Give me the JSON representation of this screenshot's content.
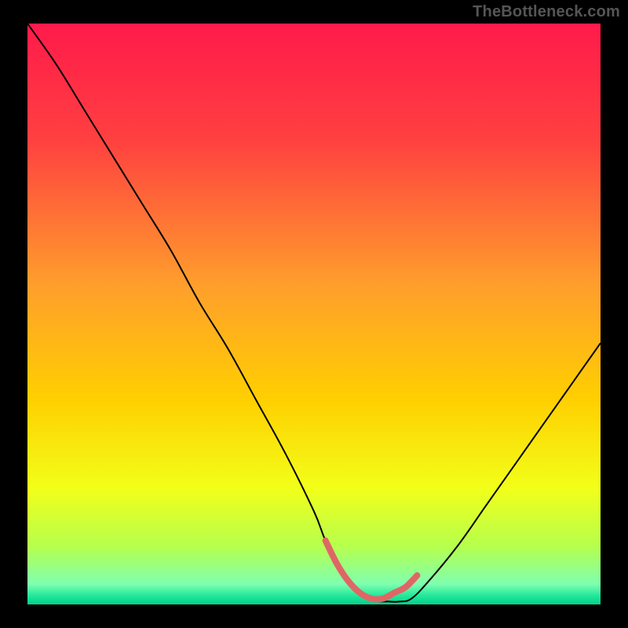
{
  "watermark": "TheBottleneck.com",
  "chart_data": {
    "type": "line",
    "title": "",
    "xlabel": "",
    "ylabel": "",
    "xlim": [
      0,
      100
    ],
    "ylim": [
      0,
      100
    ],
    "grid": false,
    "legend": false,
    "background_gradient_stops": [
      {
        "offset": 0.0,
        "color": "#ff1a4b"
      },
      {
        "offset": 0.2,
        "color": "#ff4040"
      },
      {
        "offset": 0.45,
        "color": "#ff9e2c"
      },
      {
        "offset": 0.65,
        "color": "#ffd000"
      },
      {
        "offset": 0.8,
        "color": "#f2ff19"
      },
      {
        "offset": 0.9,
        "color": "#b6ff4d"
      },
      {
        "offset": 0.965,
        "color": "#7fffb0"
      },
      {
        "offset": 0.985,
        "color": "#22e89b"
      },
      {
        "offset": 1.0,
        "color": "#00d18a"
      }
    ],
    "series": [
      {
        "name": "bottleneck-curve",
        "color": "#000000",
        "width": 2,
        "x": [
          0,
          5,
          10,
          15,
          20,
          25,
          30,
          35,
          40,
          45,
          50,
          52,
          55,
          60,
          63,
          65,
          67,
          70,
          75,
          80,
          85,
          90,
          95,
          100
        ],
        "y": [
          100,
          93,
          85,
          77,
          69,
          61,
          52,
          44,
          35,
          26,
          16,
          11,
          5,
          1,
          0.5,
          0.5,
          1,
          4,
          10,
          17,
          24,
          31,
          38,
          45
        ]
      },
      {
        "name": "optimal-band",
        "color": "#e06666",
        "width": 8,
        "x": [
          52,
          54,
          56,
          58,
          60,
          62,
          64,
          66,
          68
        ],
        "y": [
          11,
          7,
          4,
          2,
          1,
          1,
          2,
          3,
          5
        ]
      }
    ]
  }
}
